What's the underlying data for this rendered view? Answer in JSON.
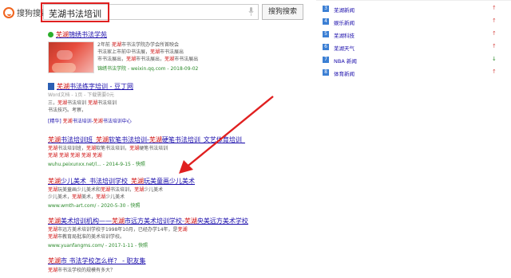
{
  "header": {
    "logo_text": "搜狗搜索",
    "query": "芜湖书法培训",
    "search_button": "搜狗搜索"
  },
  "results": [
    {
      "title": "芜湖锦绣书法学苑",
      "source_meta": "2年前 -",
      "snippet": [
        "芜湖市书法学院办学会所首映会",
        "书法家上市前中书法展，芜湖市书法展出",
        "市书法展出，芜湖市书法展出，芜湖市书法展出"
      ],
      "url": "锦绣书法学院 - weixin.qq.com - 2018-09-02"
    },
    {
      "title": "芜湖书法练字培训 - 豆丁网",
      "source_meta": "Word文档 - 1页 - 下载需要0元",
      "snippet": [
        "三，芜湖书法培训 芜湖书法培训",
        "书法技巧。考察，"
      ],
      "ad_line": "[精华] 芜湖书法培训-芜湖书法培训中心",
      "url": ""
    },
    {
      "title": "芜湖书法培训班_芜湖软笔书法培训-芜湖硬笔书法培训_文艺体育培训_",
      "snippet": [
        "芜湖书法培训班，芜湖软笔书法培训，芜湖硬笔书法培训",
        "芜湖 芜湖 芜湖 芜湖 芜湖"
      ],
      "url": "wuhu.peixunxx.net/l... - 2014-9-15 - 快照"
    },
    {
      "title": "芜湖少儿美术_书法培训学校_芜湖玩美童画少儿美术",
      "snippet": [
        "芜湖玩美童画少儿美术和芜湖书法培训，芜湖少儿美术",
        "少儿美术，芜湖美术，芜湖少儿美术"
      ],
      "url": "www.wmth-art.com/ - 2020-5-30 - 快照"
    },
    {
      "title": "芜湖美术培训机构——芜湖市远方美术培训学校-芜湖央美远方美术学校",
      "snippet": [
        "芜湖市远方美术培训学校于1998年10月，已经办学14年，是芜湖",
        "芜湖市教育局批准的美术培训学校。"
      ],
      "url": "www.yuanfangms.com/ - 2017-1-11 - 快照"
    },
    {
      "title": "芜湖市 书法学校怎么样？ - 职友集",
      "snippet": [
        "芜湖市书法学校的规模有多大？"
      ],
      "url": ""
    }
  ],
  "right_panel": {
    "items": [
      {
        "rank": "3",
        "label": "芜湖新闻",
        "trend": "up"
      },
      {
        "rank": "4",
        "label": "娱乐新闻",
        "trend": "up"
      },
      {
        "rank": "5",
        "label": "芜湖科技",
        "trend": "up"
      },
      {
        "rank": "6",
        "label": "芜湖天气",
        "trend": "up"
      },
      {
        "rank": "7",
        "label": "NBA 新闻",
        "trend": "down"
      },
      {
        "rank": "8",
        "label": "体育新闻",
        "trend": "up"
      }
    ]
  },
  "colors": {
    "link": "#1a0dab",
    "highlight": "#cc0000",
    "url": "#2a8a2a",
    "annotation": "#e02020"
  }
}
